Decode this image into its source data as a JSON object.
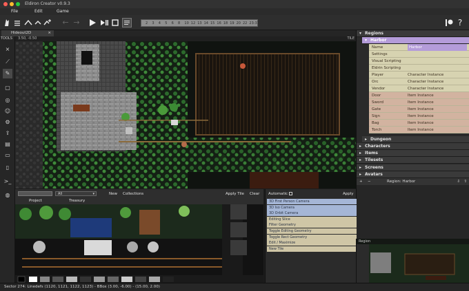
{
  "window": {
    "title": "Eldiron Creator v0.9.3"
  },
  "menu": [
    "File",
    "Edit",
    "Game"
  ],
  "timeline": {
    "ticks": [
      "2",
      "3",
      "4",
      "5",
      "6",
      "8",
      "10",
      "12",
      "13",
      "14",
      "15",
      "16",
      "18",
      "19",
      "20",
      "22",
      "23:37"
    ]
  },
  "tab": {
    "label": "Hideout2D"
  },
  "tools_label": "TOOLS",
  "coords": {
    "text": "3.50, -0.50"
  },
  "tile_label": "TILE",
  "right_panel": {
    "regions_label": "Regions",
    "harbor_label": "Harbor",
    "properties": [
      {
        "key": "Name",
        "value": "Harbor",
        "style": "name"
      },
      {
        "key": "Settings",
        "value": "",
        "style": "plain"
      },
      {
        "key": "Visual Scripting",
        "value": "",
        "style": "plain"
      },
      {
        "key": "Eldrin Scripting",
        "value": "",
        "style": "plain"
      },
      {
        "key": "Player",
        "value": "Character Instance",
        "style": "plain"
      },
      {
        "key": "Orc",
        "value": "Character Instance",
        "style": "plain"
      },
      {
        "key": "Vendor",
        "value": "Character Instance",
        "style": "plain"
      },
      {
        "key": "Door",
        "value": "Item Instance",
        "style": "item"
      },
      {
        "key": "Sword",
        "value": "Item Instance",
        "style": "item"
      },
      {
        "key": "Gate",
        "value": "Item Instance",
        "style": "item"
      },
      {
        "key": "Sign",
        "value": "Item Instance",
        "style": "item"
      },
      {
        "key": "Bag",
        "value": "Item Instance",
        "style": "item"
      },
      {
        "key": "Torch",
        "value": "Item Instance",
        "style": "item"
      }
    ],
    "dungeon_label": "Dungeon",
    "sections": [
      "Characters",
      "Items",
      "Tilesets",
      "Screens",
      "Avatars"
    ],
    "footer": {
      "region_label": "Region: Harbor"
    }
  },
  "tileset_bar": {
    "filter_value": "All",
    "new_label": "New",
    "collections_label": "Collections",
    "apply_tile_label": "Apply Tile",
    "clear_label": "Clear",
    "project_label": "Project",
    "treasury_label": "Treasury"
  },
  "commands": {
    "automatic_label": "Automatic",
    "apply_label": "Apply",
    "items": [
      {
        "label": "3D First Person Camera",
        "style": "blue"
      },
      {
        "label": "3D Iso Camera",
        "style": "blue"
      },
      {
        "label": "3D Orbit Camera",
        "style": "blue"
      },
      {
        "label": "Editing Slice",
        "style": "tan"
      },
      {
        "label": "Filter Geometry",
        "style": "tan"
      },
      {
        "label": "Toggle Editing Geometry",
        "style": "tan"
      },
      {
        "label": "Toggle Rect Geometry",
        "style": "tan"
      },
      {
        "label": "Edit / Maximize",
        "style": "tan"
      },
      {
        "label": "New Tile",
        "style": "tan"
      }
    ]
  },
  "minimap": {
    "label": "Region"
  },
  "status": {
    "text": "Sector 274: Linedefs (1120, 1121, 1122, 1123) - BBox (3.00, -6.00) - (15.00, 2.00)"
  },
  "colors": {
    "accent_purple": "#b49cd9",
    "prop_plain": "#d7d3b1",
    "prop_item": "#d2b3a0",
    "cmd_blue": "#a5b6d6",
    "cmd_tan": "#cfc6a6"
  }
}
